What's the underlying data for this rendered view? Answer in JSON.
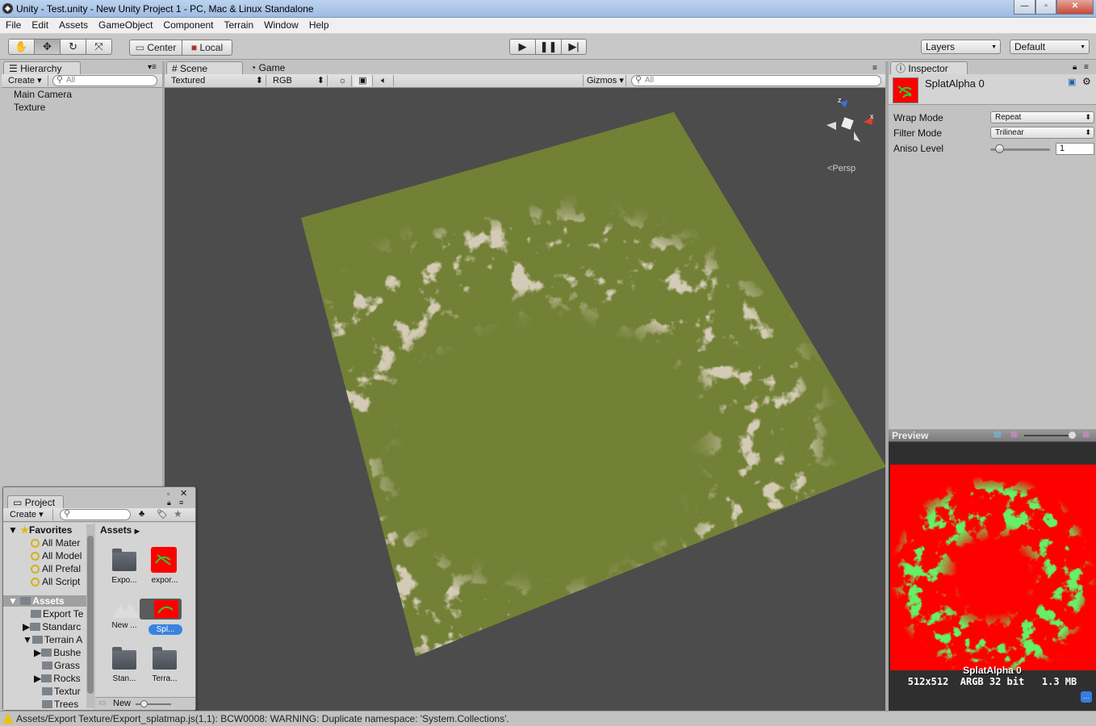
{
  "window": {
    "title": "Unity - Test.unity - New Unity Project 1 - PC, Mac & Linux Standalone",
    "app_icon": "unity-icon"
  },
  "menu": [
    "File",
    "Edit",
    "Assets",
    "GameObject",
    "Component",
    "Terrain",
    "Window",
    "Help"
  ],
  "toolbar": {
    "tools": [
      "hand-icon",
      "move-icon",
      "rotate-icon",
      "scale-icon"
    ],
    "pivot_center": "Center",
    "pivot_local": "Local",
    "play_icons": [
      "play-icon",
      "pause-icon",
      "step-icon"
    ],
    "layers": "Layers",
    "layout": "Default"
  },
  "hierarchy": {
    "tab": "Hierarchy",
    "create": "Create",
    "search_placeholder": "All",
    "items": [
      "Main Camera",
      "Texture"
    ]
  },
  "scene": {
    "tab_scene": "Scene",
    "tab_game": "Game",
    "render_mode": "Textured",
    "color_mode": "RGB",
    "gizmos": "Gizmos",
    "search_placeholder": "All",
    "gizmo_x": "x",
    "gizmo_z": "z",
    "persp": "Persp",
    "colors": {
      "background": "#4c4c4c",
      "terrain": "#6b7a2e",
      "dirt": "#a89a78"
    }
  },
  "inspector": {
    "tab": "Inspector",
    "asset_name": "SplatAlpha 0",
    "wrap_mode_label": "Wrap Mode",
    "wrap_mode": "Repeat",
    "filter_mode_label": "Filter Mode",
    "filter_mode": "Trilinear",
    "aniso_label": "Aniso Level",
    "aniso_value": "1",
    "aniso_fraction": 0.1
  },
  "preview": {
    "title": "Preview",
    "name": "SplatAlpha 0",
    "info": "512x512  ARGB 32 bit   1.3 MB",
    "colors": {
      "base": "#ff0000",
      "splat": "#22dd22"
    }
  },
  "project": {
    "tab": "Project",
    "create": "Create",
    "favorites_label": "Favorites",
    "favorites": [
      "All Mater",
      "All Model",
      "All Prefal",
      "All Script"
    ],
    "assets_label": "Assets",
    "tree": [
      "Export Te",
      "Standarc",
      "Terrain A",
      "Bushe",
      "Grass",
      "Rocks",
      "Textur",
      "Trees"
    ],
    "breadcrumb": "Assets",
    "grid": [
      {
        "label": "Expo...",
        "kind": "folder"
      },
      {
        "label": "expor...",
        "kind": "splat"
      },
      {
        "label": "New ...",
        "kind": "terrain"
      },
      {
        "label": "Spl...",
        "kind": "splat-selected"
      },
      {
        "label": "Stan...",
        "kind": "folder"
      },
      {
        "label": "Terra...",
        "kind": "folder"
      }
    ],
    "footer_new": "New"
  },
  "status": {
    "message": "Assets/Export Texture/Export_splatmap.js(1,1): BCW0008: WARNING: Duplicate namespace: 'System.Collections'."
  }
}
